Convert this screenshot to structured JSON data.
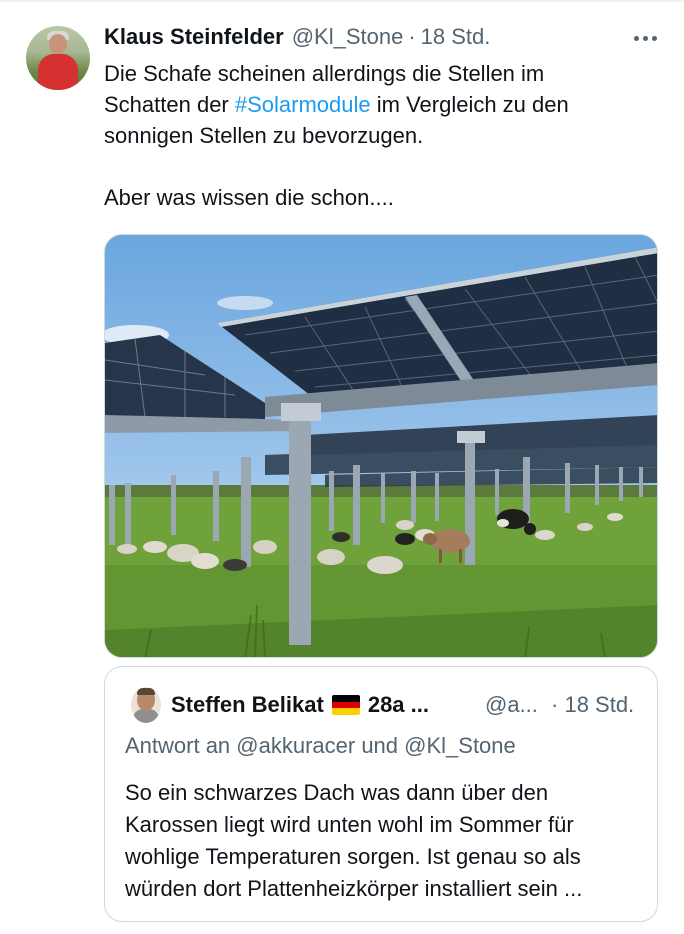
{
  "tweet": {
    "author_name": "Klaus Steinfelder",
    "handle": "@Kl_Stone",
    "separator": "·",
    "time": "18 Std.",
    "text_lines": [
      {
        "before": "Die Schafe scheinen allerdings die Stellen im",
        "hashtag": "",
        "after": ""
      },
      {
        "before": "Schatten der ",
        "hashtag": "#Solarmodule",
        "after": " im Vergleich zu den"
      },
      {
        "before": "sonnigen Stellen zu bevorzugen.",
        "hashtag": "",
        "after": ""
      },
      {
        "before": "Aber was wissen die schon....",
        "hashtag": "",
        "after": ""
      }
    ],
    "more_icon": "more-horizontal-icon"
  },
  "quoted_tweet": {
    "author_name": "Steffen Belikat",
    "badge": "28a ...",
    "flag_icon": "germany-flag-icon",
    "handle": "@a...",
    "separator": "·",
    "time": "18 Std.",
    "reply_to": "Antwort an @akkuracer und @Kl_Stone",
    "text_lines": [
      "So ein schwarzes Dach was dann über den",
      "Karossen liegt wird unten wohl im Sommer für",
      "wohlige Temperaturen sorgen. Ist genau so als",
      "würden dort Plattenheizkörper installiert sein ..."
    ]
  },
  "colors": {
    "text": "#0f1419",
    "secondary": "#536471",
    "link": "#1d9bf0",
    "border": "#cfd9de"
  }
}
